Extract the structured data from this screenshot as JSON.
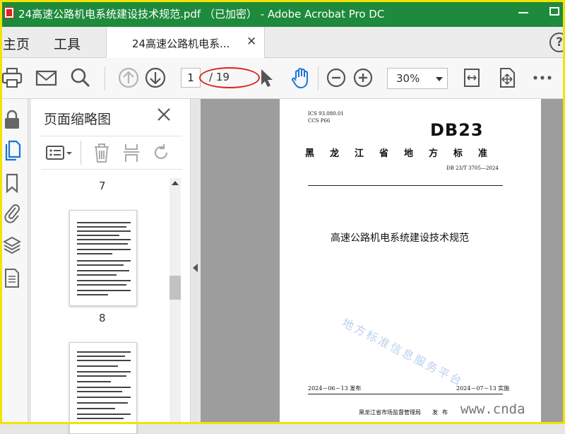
{
  "window": {
    "title": "24高速公路机电系统建设技术规范.pdf （已加密） - Adobe Acrobat Pro DC"
  },
  "tabs": {
    "home": "主页",
    "tools": "工具",
    "document": "24高速公路机电系..."
  },
  "toolbar": {
    "current_page": "1",
    "total_pages": "/ 19",
    "zoom": "30%",
    "icons": [
      "print-icon",
      "email-icon",
      "search-icon",
      "prev-page-icon",
      "next-page-icon",
      "select-cursor-icon",
      "hand-icon",
      "zoom-out-icon",
      "zoom-in-icon",
      "fit-page-icon",
      "scroll-mode-icon",
      "more-icon"
    ]
  },
  "sidebar": {
    "icons": [
      "lock-icon",
      "pages-icon",
      "bookmark-icon",
      "attachment-icon",
      "layers-icon",
      "document-properties-icon"
    ]
  },
  "thumbnail_panel": {
    "title": "页面缩略图",
    "labels": [
      "7",
      "8"
    ]
  },
  "document": {
    "ics_line": "ICS  93.080.01",
    "ccs_line": "CCS  P66",
    "logo": "DB23",
    "standard_title": "黑龙江省地方标准",
    "standard_number": "DB 23/T 3705—2024",
    "main_title": "高速公路机电系统建设技术规范",
    "watermark": "地方标准信息服务平台",
    "issue_date": "2024－06－13 发布",
    "implement_date": "2024－07－13 实施",
    "publisher": "黑龙江省市场监督管理局",
    "publish_word": "发布"
  },
  "overlay": {
    "site_watermark": "www.cnda"
  },
  "colors": {
    "title_bar": "#1e8a3c",
    "frame": "#f2e400",
    "annotation": "#e02020",
    "hand_tool": "#1a73d9"
  }
}
